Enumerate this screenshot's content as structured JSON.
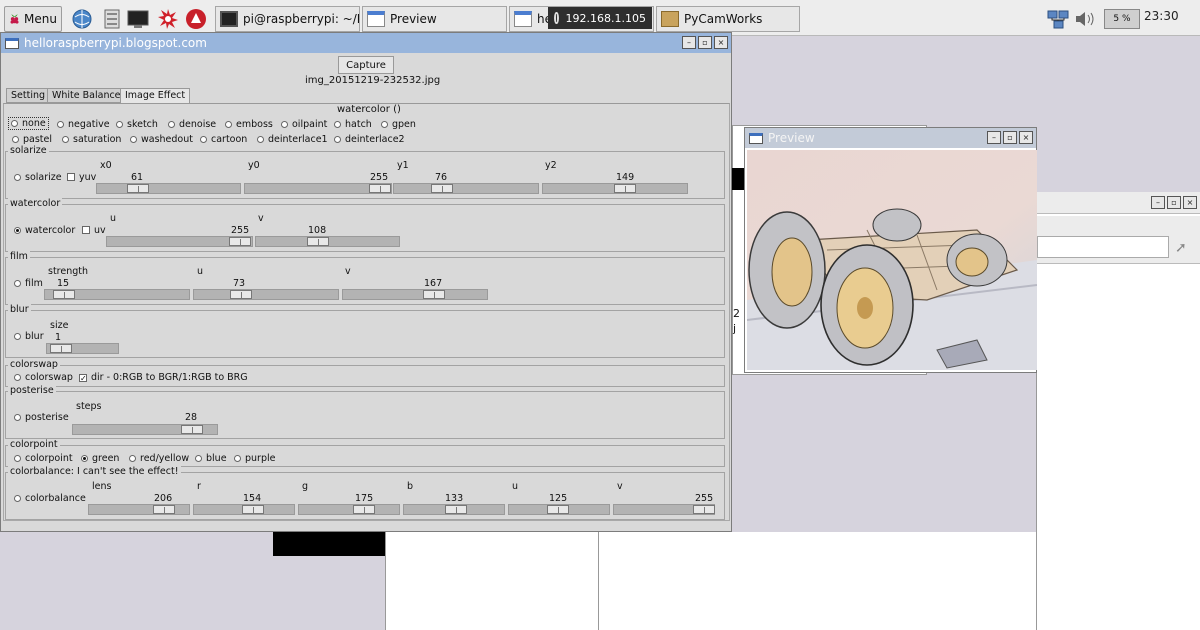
{
  "taskbar": {
    "menu_label": "Menu",
    "tasks": [
      {
        "label": "pi@raspberrypi: ~/Py..."
      },
      {
        "label": "Preview"
      },
      {
        "label": "he"
      },
      {
        "label": "PyCamWorks"
      }
    ],
    "ip_label": "192.168.1.105",
    "cpu_label": "5 %",
    "clock": "23:30"
  },
  "main_window": {
    "title": "helloraspberrypi.blogspot.com",
    "capture_label": "Capture",
    "filename": "img_20151219-232532.jpg",
    "tabs": [
      {
        "label": "Setting"
      },
      {
        "label": "White Balance"
      },
      {
        "label": "Image Effect"
      }
    ],
    "effect_current": "watercolor ()",
    "effects_row1": [
      "none",
      "negative",
      "sketch",
      "denoise",
      "emboss",
      "oilpaint",
      "hatch",
      "gpen"
    ],
    "effects_row2": [
      "pastel",
      "saturation",
      "washedout",
      "cartoon",
      "deinterlace1",
      "deinterlace2"
    ],
    "solarize": {
      "frame_label": "solarize",
      "radio_label": "solarize",
      "check_label": "yuv",
      "sliders": [
        {
          "name": "x0",
          "value": "61"
        },
        {
          "name": "y0",
          "value": "255"
        },
        {
          "name": "y1",
          "value": "76"
        },
        {
          "name": "y2",
          "value": "149"
        }
      ]
    },
    "watercolor": {
      "frame_label": "watercolor",
      "radio_label": "watercolor",
      "check_label": "uv",
      "sliders": [
        {
          "name": "u",
          "value": "255"
        },
        {
          "name": "v",
          "value": "108"
        }
      ]
    },
    "film": {
      "frame_label": "film",
      "radio_label": "film",
      "sliders": [
        {
          "name": "strength",
          "value": "15"
        },
        {
          "name": "u",
          "value": "73"
        },
        {
          "name": "v",
          "value": "167"
        }
      ]
    },
    "blur": {
      "frame_label": "blur",
      "radio_label": "blur",
      "sliders": [
        {
          "name": "size",
          "value": "1"
        }
      ]
    },
    "colorswap": {
      "frame_label": "colorswap",
      "radio_label": "colorswap",
      "check_label": "dir - 0:RGB to BGR/1:RGB to BRG"
    },
    "posterise": {
      "frame_label": "posterise",
      "radio_label": "posterise",
      "sliders": [
        {
          "name": "steps",
          "value": "28"
        }
      ]
    },
    "colorpoint": {
      "frame_label": "colorpoint",
      "options": [
        "colorpoint",
        "green",
        "red/yellow",
        "blue",
        "purple"
      ]
    },
    "colorbalance": {
      "frame_label": "colorbalance: I can't see the effect!",
      "radio_label": "colorbalance",
      "sliders": [
        {
          "name": "lens",
          "value": "206"
        },
        {
          "name": "r",
          "value": "154"
        },
        {
          "name": "g",
          "value": "175"
        },
        {
          "name": "b",
          "value": "133"
        },
        {
          "name": "u",
          "value": "125"
        },
        {
          "name": "v",
          "value": "255"
        }
      ]
    }
  },
  "preview_window": {
    "title": "Preview"
  },
  "background_text": {
    "line1": "2",
    "line2": "j"
  },
  "colors": {
    "main_titlebar": "#98b5dc",
    "preview_titlebar": "#c3cbd8",
    "desktop": "#d6d3dd",
    "window_bg": "#d9d9d9"
  }
}
